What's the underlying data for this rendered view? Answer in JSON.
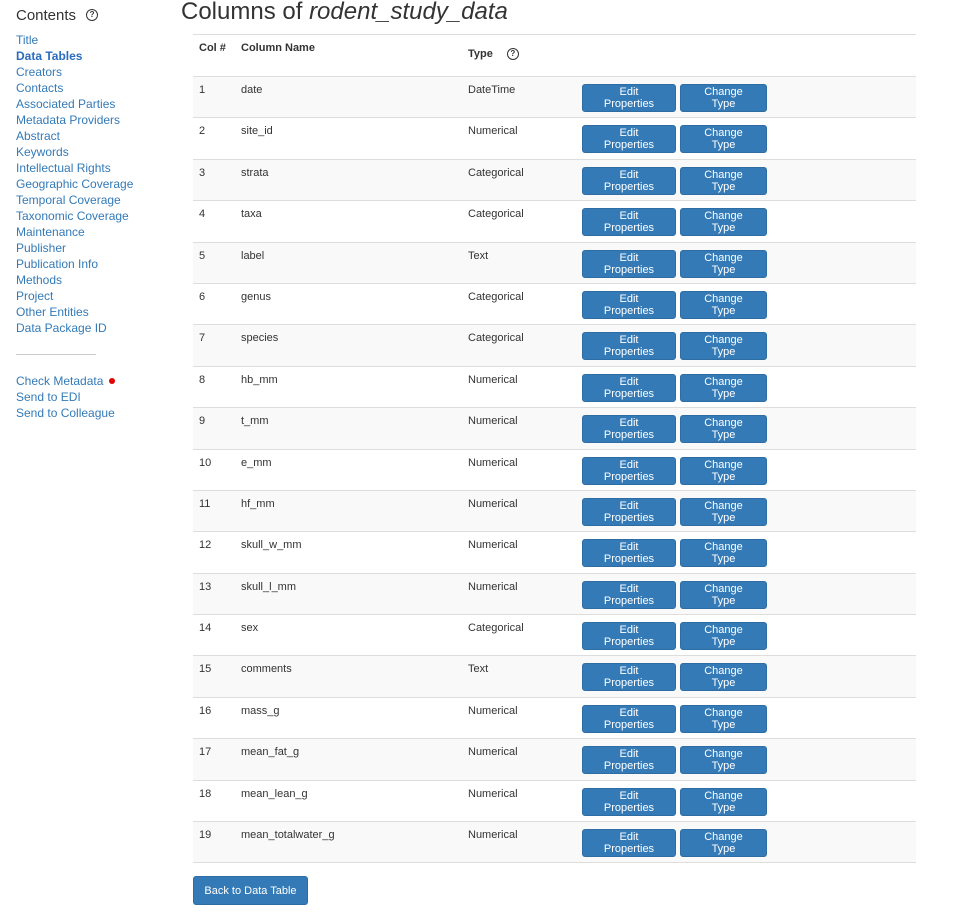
{
  "sidebar": {
    "title": "Contents",
    "help_icon": "?",
    "items": [
      {
        "label": "Title"
      },
      {
        "label": "Data Tables",
        "active": true
      },
      {
        "label": "Creators"
      },
      {
        "label": "Contacts"
      },
      {
        "label": "Associated Parties"
      },
      {
        "label": "Metadata Providers"
      },
      {
        "label": "Abstract"
      },
      {
        "label": "Keywords"
      },
      {
        "label": "Intellectual Rights"
      },
      {
        "label": "Geographic Coverage"
      },
      {
        "label": "Temporal Coverage"
      },
      {
        "label": "Taxonomic Coverage"
      },
      {
        "label": "Maintenance"
      },
      {
        "label": "Publisher"
      },
      {
        "label": "Publication Info"
      },
      {
        "label": "Methods"
      },
      {
        "label": "Project"
      },
      {
        "label": "Other Entities"
      },
      {
        "label": "Data Package ID"
      }
    ],
    "actions": [
      {
        "label": "Check Metadata",
        "status_dot": "#e00000"
      },
      {
        "label": "Send to EDI"
      },
      {
        "label": "Send to Colleague"
      }
    ]
  },
  "main": {
    "title_prefix": "Columns of ",
    "title_name": "rodent_study_data",
    "table": {
      "headers": {
        "col": "Col #",
        "name": "Column Name",
        "type": "Type",
        "type_help": "?"
      },
      "edit_label": "Edit Properties",
      "change_label": "Change Type",
      "rows": [
        {
          "num": "1",
          "name": "date",
          "type": "DateTime"
        },
        {
          "num": "2",
          "name": "site_id",
          "type": "Numerical"
        },
        {
          "num": "3",
          "name": "strata",
          "type": "Categorical"
        },
        {
          "num": "4",
          "name": "taxa",
          "type": "Categorical"
        },
        {
          "num": "5",
          "name": "label",
          "type": "Text"
        },
        {
          "num": "6",
          "name": "genus",
          "type": "Categorical"
        },
        {
          "num": "7",
          "name": "species",
          "type": "Categorical"
        },
        {
          "num": "8",
          "name": "hb_mm",
          "type": "Numerical"
        },
        {
          "num": "9",
          "name": "t_mm",
          "type": "Numerical"
        },
        {
          "num": "10",
          "name": "e_mm",
          "type": "Numerical"
        },
        {
          "num": "11",
          "name": "hf_mm",
          "type": "Numerical"
        },
        {
          "num": "12",
          "name": "skull_w_mm",
          "type": "Numerical"
        },
        {
          "num": "13",
          "name": "skull_l_mm",
          "type": "Numerical"
        },
        {
          "num": "14",
          "name": "sex",
          "type": "Categorical"
        },
        {
          "num": "15",
          "name": "comments",
          "type": "Text"
        },
        {
          "num": "16",
          "name": "mass_g",
          "type": "Numerical"
        },
        {
          "num": "17",
          "name": "mean_fat_g",
          "type": "Numerical"
        },
        {
          "num": "18",
          "name": "mean_lean_g",
          "type": "Numerical"
        },
        {
          "num": "19",
          "name": "mean_totalwater_g",
          "type": "Numerical"
        }
      ]
    },
    "back_label": "Back to Data Table"
  },
  "colors": {
    "link": "#337ab7",
    "button": "#337ab7",
    "status_dot": "#e00000"
  }
}
